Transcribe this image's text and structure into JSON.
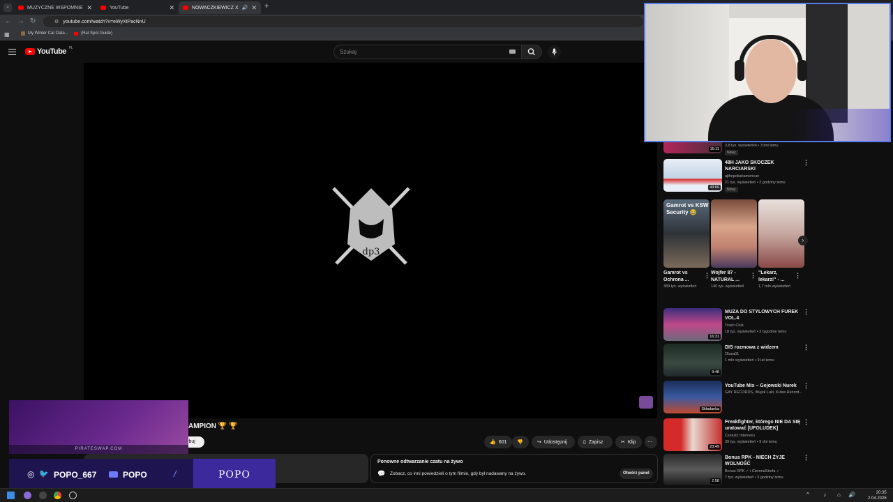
{
  "browser": {
    "tabs": [
      {
        "label": "MUZYCZNE WSPOMNIENIA KLUBO..."
      },
      {
        "label": "YouTube"
      },
      {
        "label": "NOWACZKIEWICZ X KAZKO...",
        "active": true
      }
    ],
    "url": "youtube.com/watch?v=eWyXtPacNnU",
    "bookmarks": [
      {
        "label": "My Winter Car Data..."
      },
      {
        "label": "(Rat Spot Guide)"
      }
    ]
  },
  "youtube": {
    "logo_text": "YouTube",
    "region": "PL",
    "search_placeholder": "Szukaj"
  },
  "video": {
    "title_visible": "AMPION 🏆 🏆",
    "subscribe_partial": "ybuj",
    "like_count": "601",
    "share_label": "Udostępnij",
    "save_label": "Zapisz",
    "clip_label": "Klip",
    "more_label": "⋯"
  },
  "chat_replay": {
    "title": "Ponowne odtwarzanie czatu na żywo",
    "description": "Zobacz, co inni powiedzieli o tym filmie, gdy był nadawany na żywo.",
    "open_panel_label": "Otwórz panel"
  },
  "recommendations": [
    {
      "duration": "15:11",
      "meta": "3,8 tys. wyświetleń • 3 dni temu",
      "badge": "Nowy"
    },
    {
      "title": "48H JAKO SKOCZEK NARCIARSKI",
      "channel": "ajthepoliahamerican",
      "meta": "21 tys. wyświetleń • 2 godziny temu",
      "badge": "Nowy",
      "duration": "43:06"
    },
    {
      "title": "MUZA DO STYLOWYCH FUREK VOL.4",
      "channel": "Trash Club",
      "meta": "18 tys. wyświetleń • 2 tygodnie temu",
      "duration": "16:31"
    },
    {
      "title": "DIS rozmowa z widzem",
      "channel": "Olsza01",
      "meta": "1 mln wyświetleń • 9 lat temu",
      "duration": "9:48"
    },
    {
      "title": "YouTube Mix – Gejowski Nurek",
      "channel": "GAY RECORDS, Wujek Luki, Kutas Record...",
      "duration": "Składanka"
    },
    {
      "title": "Freakfighter, którego NIE DA SIĘ uratować [UFOLUDEK]",
      "channel": "Czeluść Internetu",
      "meta": "39 tys. wyświetleń • 9 dni temu",
      "duration": "23:49"
    },
    {
      "title": "Bonus RPK - NIECH ŻYJE WOLNOŚĆ",
      "channel": "Bonus RPK ✓ i CiemnaStrefa ✓",
      "meta": "7 tys. wyświetleń • 3 godziny temu",
      "duration": "2:58"
    }
  ],
  "shorts": [
    {
      "title": "Gamrot vs Ochrona ...",
      "views": "389 tys. wyświetleń",
      "thumb_text": "Gamrot vs KSW Security 😂"
    },
    {
      "title": "Wojfer 87 - NATURAL ...",
      "views": "140 tys. wyświetleń"
    },
    {
      "title": "\"Lekarz, lekarz!\" - ...",
      "views": "1,7 mln wyświetleń"
    }
  ],
  "overlay": {
    "site": "PIRATESWAP.COM",
    "handle": "POPO_667",
    "yt_name": "POPO",
    "brand": "POPO"
  },
  "taskbar": {
    "time": "20:35",
    "date": "2.04.2026"
  },
  "colors": {
    "youtube_red": "#ff0000",
    "webcam_border": "#5a7cf0",
    "overlay_purple": "#3c2a9c"
  }
}
